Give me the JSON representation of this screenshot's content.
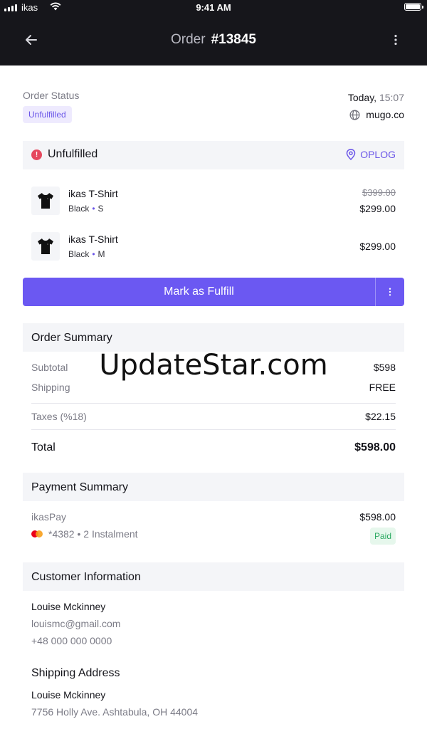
{
  "status_bar": {
    "carrier": "ikas",
    "time": "9:41 AM"
  },
  "header": {
    "label": "Order",
    "order_number": "#13845"
  },
  "order_status": {
    "label": "Order Status",
    "badge": "Unfulfilled",
    "date": "Today,",
    "time": "15:07",
    "store": "mugo.co"
  },
  "fulfillment": {
    "status": "Unfulfilled",
    "location": "OPLOG",
    "items": [
      {
        "name": "ikas T-Shirt",
        "color": "Black",
        "size": "S",
        "old_price": "$399.00",
        "price": "$299.00"
      },
      {
        "name": "ikas T-Shirt",
        "color": "Black",
        "size": "M",
        "price": "$299.00"
      }
    ],
    "button_label": "Mark as Fulfill"
  },
  "order_summary": {
    "title": "Order Summary",
    "subtotal_label": "Subtotal",
    "subtotal": "$598",
    "shipping_label": "Shipping",
    "shipping": "FREE",
    "taxes_label": "Taxes (%18)",
    "taxes": "$22.15",
    "total_label": "Total",
    "total": "$598.00"
  },
  "payment_summary": {
    "title": "Payment Summary",
    "method": "ikasPay",
    "amount": "$598.00",
    "card": "*4382 • 2 Instalment",
    "status": "Paid"
  },
  "customer": {
    "title": "Customer Information",
    "name": "Louise Mckinney",
    "email": "louismc@gmail.com",
    "phone": "+48 000 000 0000"
  },
  "shipping_address": {
    "title": "Shipping Address",
    "name": "Louise Mckinney",
    "address": "7756 Holly Ave. Ashtabula, OH 44004"
  },
  "watermark": "UpdateStar.com",
  "colors": {
    "accent": "#6b58f2",
    "header_bg": "#16161b",
    "alert": "#e5485e",
    "paid": "#2aa960"
  }
}
